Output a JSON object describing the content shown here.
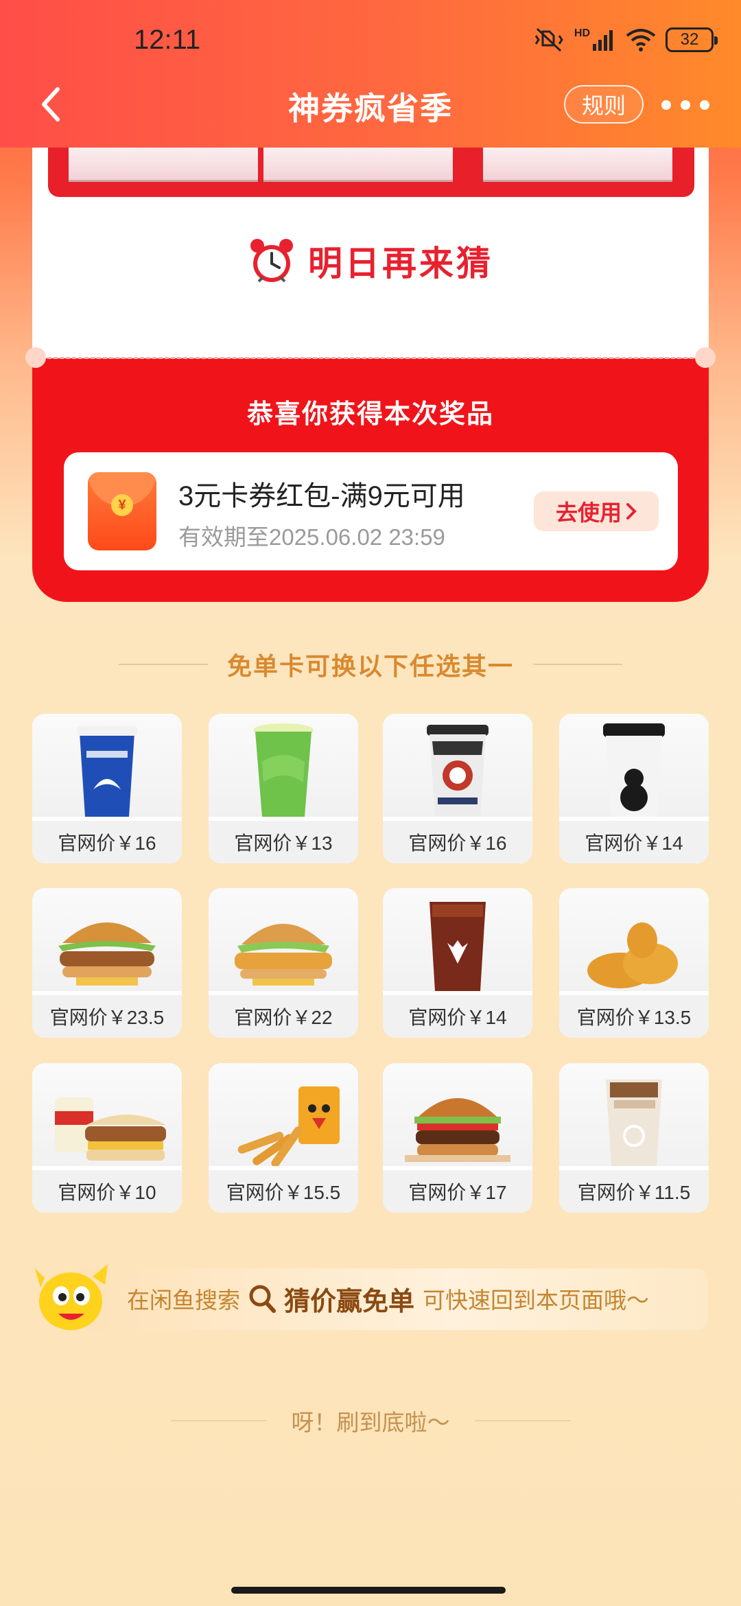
{
  "status_bar": {
    "time": "12:11",
    "network": "HD",
    "battery": "32"
  },
  "nav": {
    "title": "神券疯省季",
    "rules_label": "规则"
  },
  "guess": {
    "again_text": "明日再来猜"
  },
  "prize": {
    "title": "恭喜你获得本次奖品",
    "name": "3元卡券红包-满9元可用",
    "expiry": "有效期至2025.06.02 23:59",
    "use_label": "去使用",
    "envelope_symbol": "¥"
  },
  "section": {
    "title": "免单卡可换以下任选其一"
  },
  "products": [
    {
      "price": "官网价￥16",
      "icon": "luckin-coffee-cup"
    },
    {
      "price": "官网价￥13",
      "icon": "green-tea-drink"
    },
    {
      "price": "官网价￥16",
      "icon": "chagee-tea-cup"
    },
    {
      "price": "官网价￥14",
      "icon": "white-coffee-cup"
    },
    {
      "price": "官网价￥23.5",
      "icon": "chicken-burger"
    },
    {
      "price": "官网价￥22",
      "icon": "crispy-chicken-burger"
    },
    {
      "price": "官网价￥14",
      "icon": "iced-americano"
    },
    {
      "price": "官网价￥13.5",
      "icon": "fried-chicken"
    },
    {
      "price": "官网价￥10",
      "icon": "breakfast-burger-set"
    },
    {
      "price": "官网价￥15.5",
      "icon": "chicken-fries"
    },
    {
      "price": "官网价￥17",
      "icon": "beef-burger"
    },
    {
      "price": "官网价￥11.5",
      "icon": "iced-latte"
    }
  ],
  "tip": {
    "prefix": "在闲鱼搜索",
    "keyword": "猜价赢免单",
    "suffix": "可快速回到本页面哦～"
  },
  "footer": {
    "note": "呀！刷到底啦～"
  },
  "colors": {
    "header": "#ff5a3c",
    "prize_red": "#f0141a",
    "accent_text": "#e8212f",
    "page_bg": "#fde6bf"
  }
}
